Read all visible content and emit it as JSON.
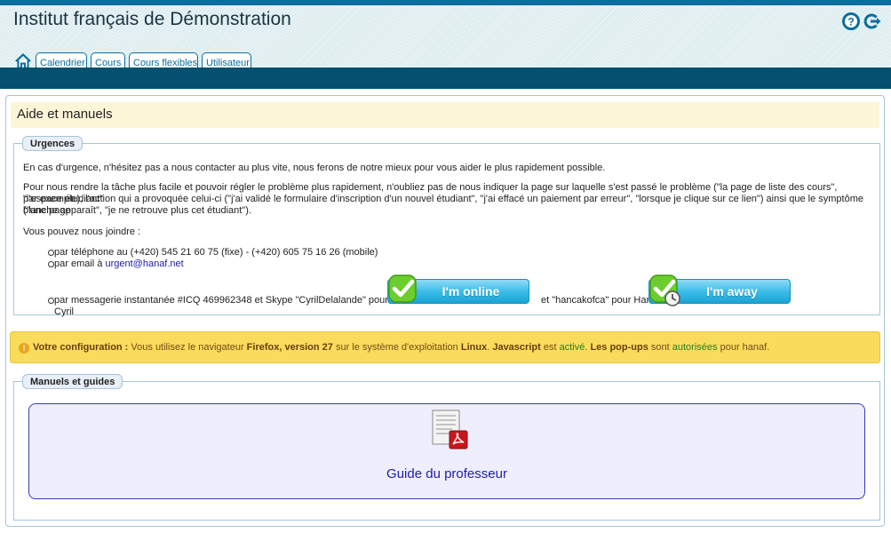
{
  "header": {
    "title": "Institut français de Démonstration",
    "tabs": [
      "Calendrier",
      "Cours",
      "Cours flexibles",
      "Utilisateur"
    ]
  },
  "page": {
    "title": "Aide et manuels"
  },
  "urgences": {
    "legend": "Urgences",
    "intro": "En cas d'urgence, n'hésitez pas a nous contacter au plus vite, nous ferons de notre mieux pour vous aider le plus rapidement possible.",
    "paragraph2_line1": "Pour nous rendre la tâche plus facile et pouvoir régler le problème plus rapidement, n'oubliez pas de nous indiquer la page sur laquelle s'est passé le problème (\"la page de liste des cours\", \"l'espace étudiant\"",
    "paragraph2_line2": "par exemple), l'action qui a provoquée celui-ci (\"j'ai validé le formulaire d'inscription d'un nouvel étudiant\", \"j'ai effacé un paiement par erreur\", \"lorsque je clique sur ce lien\") ainsi que le symptôme (\"une page",
    "paragraph2_line3": "blanche apparaît\", \"je ne retrouve plus cet étudiant\").",
    "join_label": "Vous pouvez nous joindre :",
    "phone": "par téléphone au (+420) 545 21 60 75 (fixe) - (+420) 605 75 16 26 (mobile)",
    "email_prefix": "par email à",
    "email": "urgent@hanaf.net",
    "im_text": "par messagerie instantanée #ICQ 469962348 et Skype \"CyrilDelalande\" pour Cyril",
    "im_text2": "et \"hancakofca\" pour Hana",
    "online_label": "I'm online",
    "away_label": "I'm away"
  },
  "config": {
    "label": "Votre configuration :",
    "t1": "Vous utilisez le navigateur",
    "browser": "Firefox, version 27",
    "t2": "sur le système d'exploitation",
    "os": "Linux",
    "t3": ".",
    "js_label": "Javascript",
    "t4": "est",
    "js_status": "activé",
    "t5": ".",
    "popups_label": "Les pop-ups",
    "t6": "sont",
    "popups_status": "autorisées",
    "t7": "pour hanaf."
  },
  "manuels": {
    "legend": "Manuels et guides",
    "guide_label": "Guide du professeur"
  },
  "colors": {
    "brand": "#0b6e9c",
    "navbar": "#03506f",
    "config_bg": "#f9dc5c",
    "online_green": "#5cbf2a"
  }
}
